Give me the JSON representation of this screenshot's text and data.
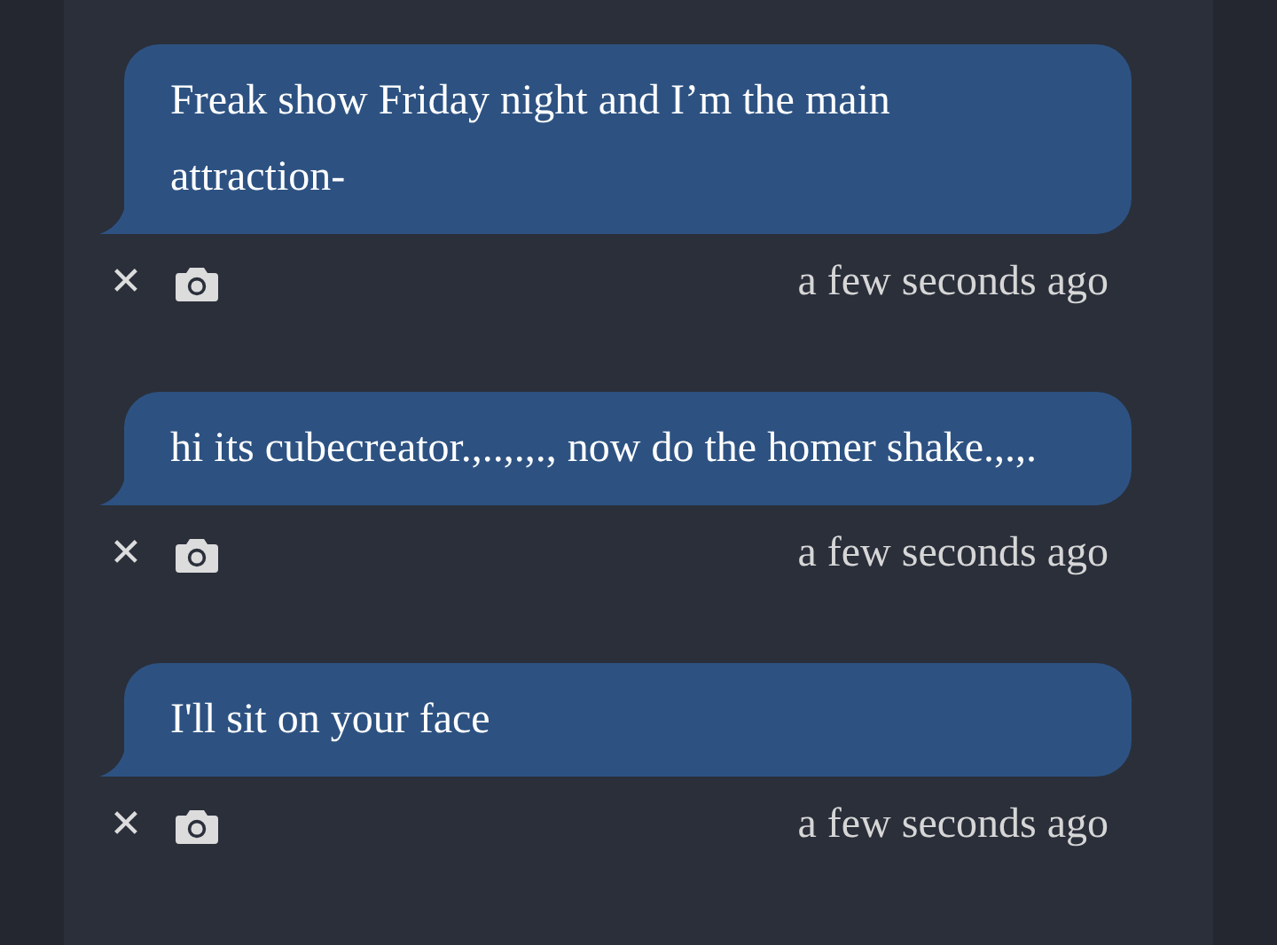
{
  "messages": [
    {
      "text": "Freak show Friday night and I’m the main attraction-",
      "delete_icon": "✕",
      "time": "a few seconds ago"
    },
    {
      "text": "hi its cubecreator.,..,.,., now do the homer shake.,.,.",
      "delete_icon": "✕",
      "time": "a few seconds ago"
    },
    {
      "text": "I'll sit on your face",
      "delete_icon": "✕",
      "time": "a few seconds ago"
    }
  ]
}
